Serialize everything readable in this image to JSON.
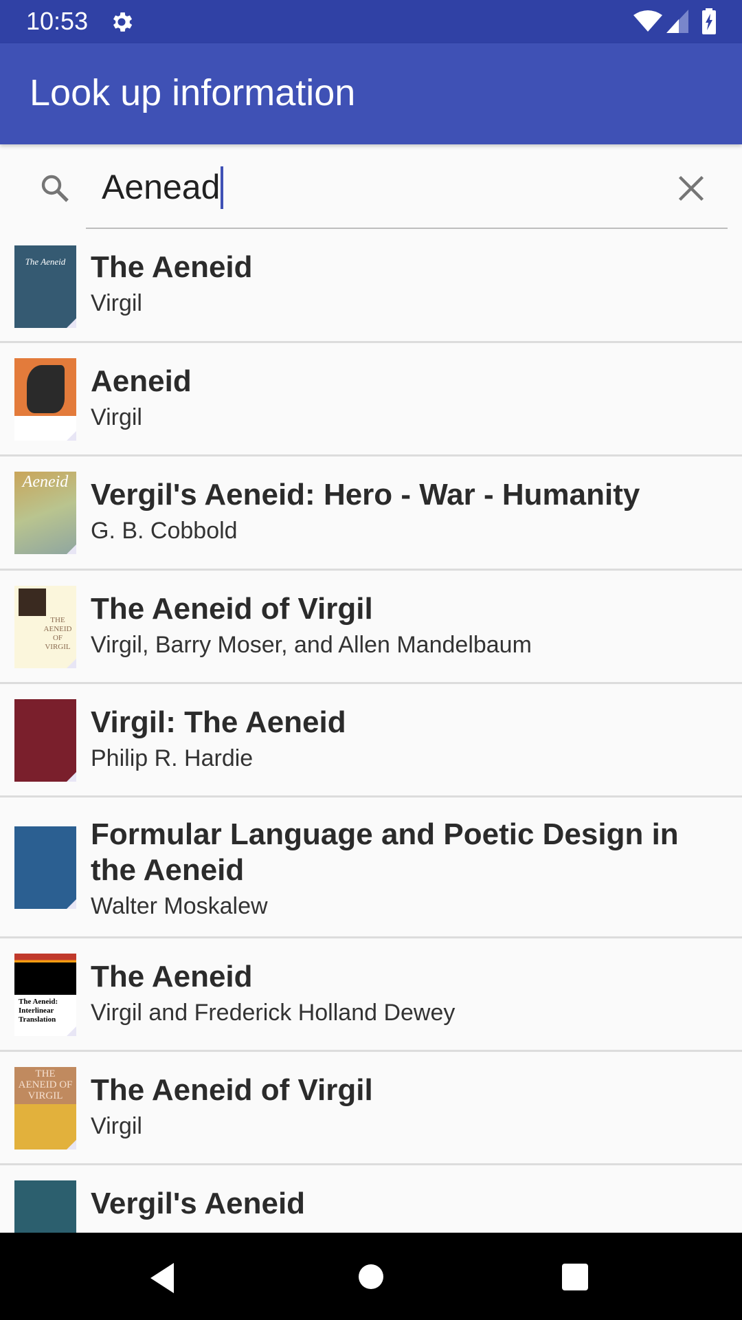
{
  "status_bar": {
    "time": "10:53",
    "icons": [
      "gear-icon",
      "wifi-icon",
      "signal-icon",
      "battery-charging-icon"
    ]
  },
  "app_bar": {
    "title": "Look up information"
  },
  "search": {
    "value": "Aenead",
    "icons": {
      "leading": "search-icon",
      "trailing": "close-icon"
    }
  },
  "results": [
    {
      "title": "The Aeneid",
      "author": "Virgil",
      "cover_color": "#355a72",
      "cover_text": "The Aeneid"
    },
    {
      "title": "Aeneid",
      "author": "Virgil",
      "cover_color": "#e37b3b",
      "cover_text": ""
    },
    {
      "title": "Vergil's Aeneid: Hero - War - Humanity",
      "author": "G. B. Cobbold",
      "cover_color": "#c9b27a",
      "cover_text": "Aeneid"
    },
    {
      "title": "The Aeneid of Virgil",
      "author": "Virgil, Barry Moser, and Allen Mandelbaum",
      "cover_color": "#fbf6dc",
      "cover_text": "THE AENEID OF VIRGIL"
    },
    {
      "title": "Virgil: The Aeneid",
      "author": "Philip R. Hardie",
      "cover_color": "#7a1f2c",
      "cover_text": ""
    },
    {
      "title": "Formular Language and Poetic Design in the Aeneid",
      "author": "Walter Moskalew",
      "cover_color": "#2b5f91",
      "cover_text": ""
    },
    {
      "title": "The Aeneid",
      "author": "Virgil and Frederick Holland Dewey",
      "cover_color": "#000000",
      "cover_text": "The Aeneid: Interlinear Translation"
    },
    {
      "title": "The Aeneid of Virgil",
      "author": "Virgil",
      "cover_color": "#c08a5f",
      "cover_text": "THE AENEID OF VIRGIL"
    },
    {
      "title": "Vergil's Aeneid",
      "author": "",
      "cover_color": "#2c5f6e",
      "cover_text": ""
    }
  ],
  "nav_bar": {
    "buttons": [
      "back",
      "home",
      "recents"
    ]
  }
}
